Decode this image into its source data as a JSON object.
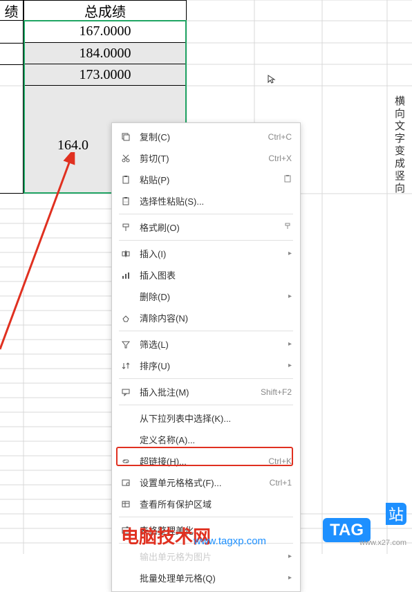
{
  "header": {
    "col1": "绩",
    "col2": "总成绩"
  },
  "cells": [
    "167.0000",
    "184.0000",
    "173.0000",
    "164.0"
  ],
  "vertical_label": "横向文字变成竖向",
  "menu": {
    "copy": "复制(C)",
    "copy_sc": "Ctrl+C",
    "cut": "剪切(T)",
    "cut_sc": "Ctrl+X",
    "paste": "粘贴(P)",
    "paste_special": "选择性粘贴(S)...",
    "format_painter": "格式刷(O)",
    "insert": "插入(I)",
    "insert_chart": "插入图表",
    "delete": "删除(D)",
    "clear": "清除内容(N)",
    "filter": "筛选(L)",
    "sort": "排序(U)",
    "comment": "插入批注(M)",
    "comment_sc": "Shift+F2",
    "dropdown": "从下拉列表中选择(K)...",
    "define_name": "定义名称(A)...",
    "hyperlink": "超链接(H)...",
    "hyperlink_sc": "Ctrl+K",
    "format_cells": "设置单元格格式(F)...",
    "format_cells_sc": "Ctrl+1",
    "protection": "查看所有保护区域",
    "beautify": "表格整理美化",
    "output_img": "输出单元格为图片",
    "batch": "批量处理单元格(Q)"
  },
  "watermark": {
    "title": "电脑技术网",
    "tag": "TAG",
    "url": "www.tagxp.com",
    "url2": "站",
    "url3": "www.x27.com"
  }
}
